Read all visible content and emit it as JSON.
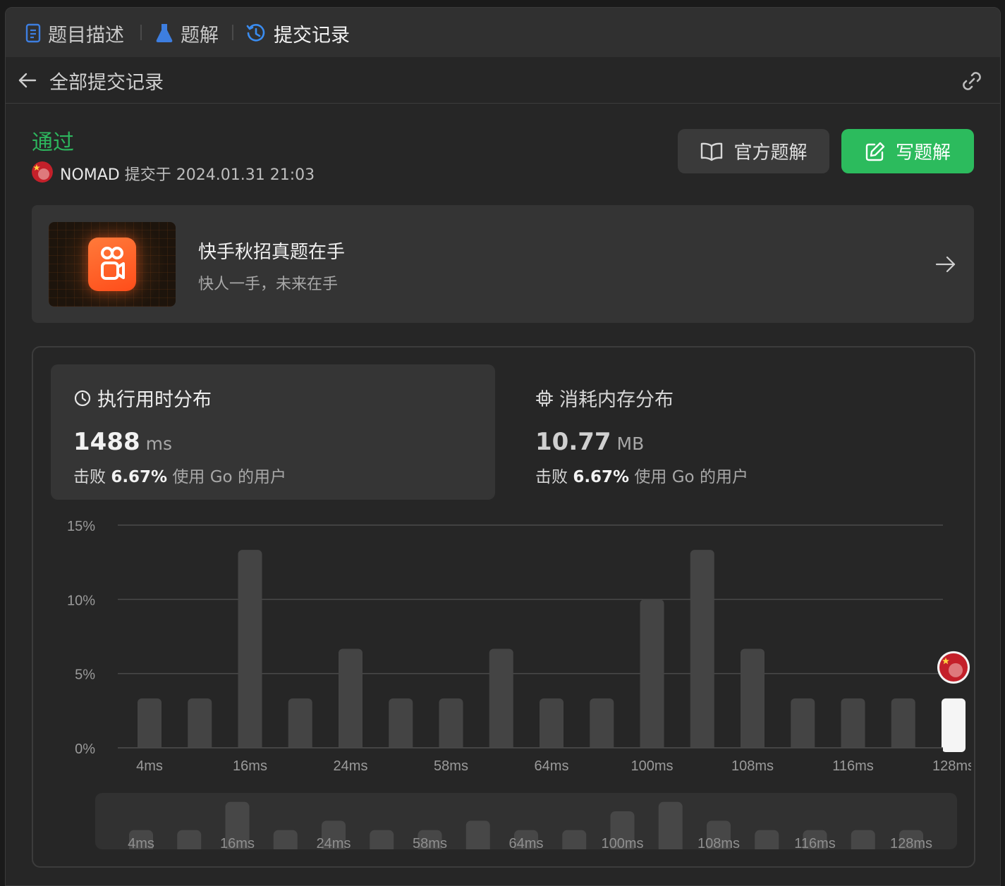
{
  "tabs": [
    {
      "label": "题目描述",
      "icon": "document-icon",
      "active": false
    },
    {
      "label": "题解",
      "icon": "flask-icon",
      "active": false
    },
    {
      "label": "提交记录",
      "icon": "history-icon",
      "active": true
    }
  ],
  "subheader": {
    "title": "全部提交记录",
    "back_icon": "arrow-left-icon",
    "link_icon": "link-icon"
  },
  "submission": {
    "status": "通过",
    "user": "NOMAD",
    "submitted_text": "提交于",
    "datetime": "2024.01.31 21:03",
    "status_color": "#2db55d"
  },
  "buttons": {
    "official": "官方题解",
    "write": "写题解"
  },
  "promo": {
    "title": "快手秋招真题在手",
    "subtitle": "快人一手，未来在手"
  },
  "runtime": {
    "title": "执行用时分布",
    "value": "1488",
    "unit": "ms",
    "beats_prefix": "击败",
    "beats": "6.67%",
    "beats_suffix": "使用 Go 的用户"
  },
  "memory": {
    "title": "消耗内存分布",
    "value": "10.77",
    "unit": "MB",
    "beats_prefix": "击败",
    "beats": "6.67%",
    "beats_suffix": "使用 Go 的用户"
  },
  "chart_data": {
    "type": "bar",
    "title": "",
    "xlabel": "",
    "ylabel": "",
    "ylim": [
      0,
      15
    ],
    "yticks": [
      "0%",
      "5%",
      "10%",
      "15%"
    ],
    "ytick_values": [
      0,
      5,
      10,
      15
    ],
    "xtick_labels": [
      "4ms",
      "16ms",
      "24ms",
      "58ms",
      "64ms",
      "100ms",
      "108ms",
      "116ms",
      "128ms"
    ],
    "values": [
      3.33,
      3.33,
      13.33,
      3.33,
      6.67,
      3.33,
      3.33,
      6.67,
      3.33,
      3.33,
      10.0,
      13.33,
      6.67,
      3.33,
      3.33,
      3.33,
      3.33
    ],
    "highlight_index": 16,
    "bar_color": "#444444",
    "highlight_color": "#f5f5f5",
    "grid": true
  }
}
